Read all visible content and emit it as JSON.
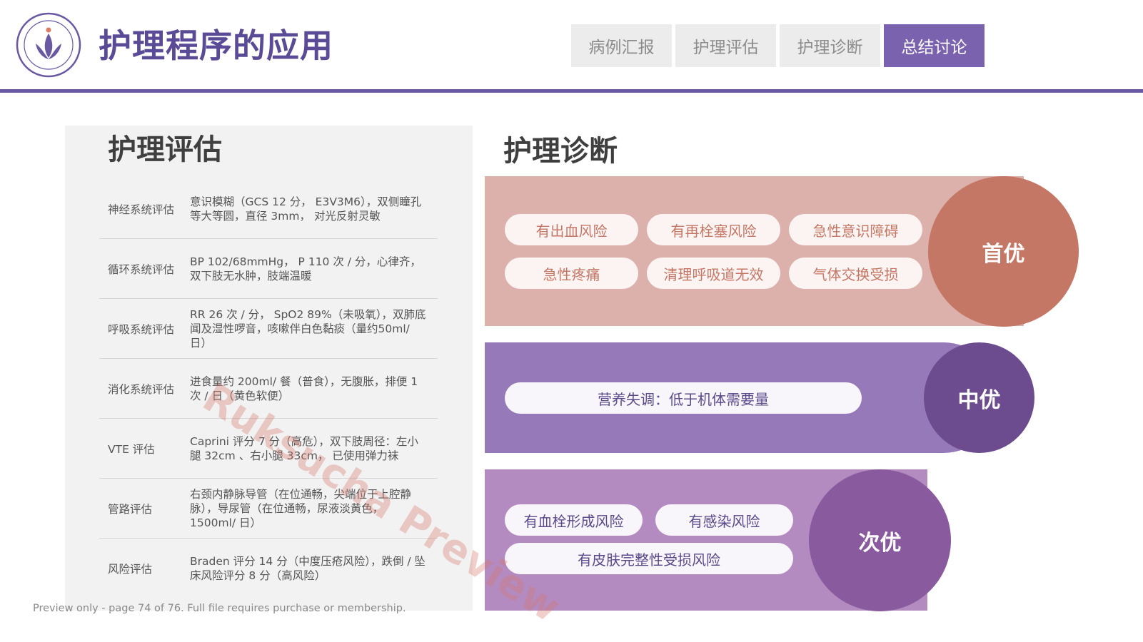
{
  "header": {
    "title": "护理程序的应用",
    "tabs": [
      {
        "label": "病例汇报",
        "active": false
      },
      {
        "label": "护理评估",
        "active": false
      },
      {
        "label": "护理诊断",
        "active": false
      },
      {
        "label": "总结讨论",
        "active": true
      }
    ]
  },
  "colors": {
    "brand_purple": "#5b4a96",
    "active_tab": "#7b62ae",
    "first_priority": "#c57765",
    "mid_priority": "#6c4c8e",
    "low_priority": "#8a5a9f"
  },
  "assessment": {
    "title": "护理评估",
    "rows": [
      {
        "label": "神经系统评估",
        "text": "意识模糊（GCS 12 分， E3V3M6），双侧瞳孔等大等圆，直径 3mm， 对光反射灵敏"
      },
      {
        "label": "循环系统评估",
        "text": "BP 102/68mmHg， P 110 次 / 分，心律齐，双下肢无水肿，肢端温暖"
      },
      {
        "label": "呼吸系统评估",
        "text": "RR 26 次 / 分， SpO2 89%（未吸氧），双肺底闻及湿性啰音，咳嗽伴白色黏痰（量约50ml/ 日）"
      },
      {
        "label": "消化系统评估",
        "text": "进食量约 200ml/ 餐（普食），无腹胀，排便 1 次 / 日（黄色软便）"
      },
      {
        "label": "VTE 评估",
        "text": "Caprini 评分 7 分（高危），双下肢周径：左小腿 32cm 、右小腿 33cm， 已使用弹力袜"
      },
      {
        "label": "管路评估",
        "text": "右颈内静脉导管（在位通畅，尖端位于上腔静脉），导尿管（在位通畅，尿液淡黄色，1500ml/ 日）"
      },
      {
        "label": "风险评估",
        "text": "Braden 评分 14 分（中度压疮风险），跌倒 / 坠床风险评分 8 分（高风险）"
      }
    ]
  },
  "diagnosis": {
    "title": "护理诊断",
    "first": {
      "label": "首优",
      "items": [
        "有出血风险",
        "有再栓塞风险",
        "急性意识障碍",
        "急性疼痛",
        "清理呼吸道无效",
        "气体交换受损"
      ]
    },
    "mid": {
      "label": "中优",
      "items": [
        "营养失调：低于机体需要量"
      ]
    },
    "low": {
      "label": "次优",
      "items": [
        "有血栓形成风险",
        "有感染风险",
        "有皮肤完整性受损风险"
      ]
    }
  },
  "footer": {
    "note": "Preview only - page 74 of 76. Full file requires purchase or membership.",
    "watermark": "Ruksucha Preview"
  }
}
